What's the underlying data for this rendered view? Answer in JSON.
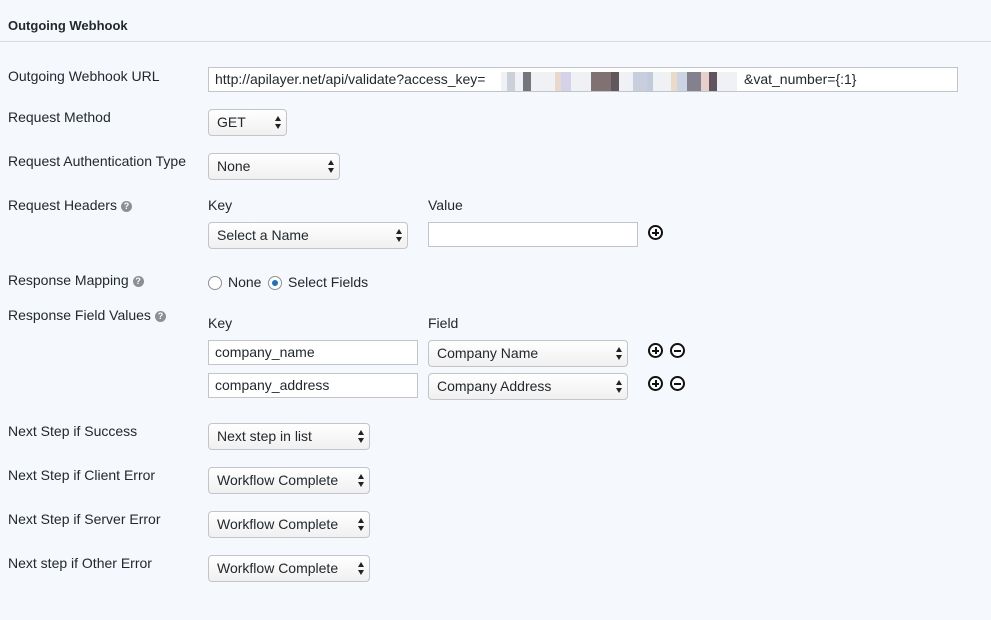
{
  "section": {
    "title": "Outgoing Webhook"
  },
  "fields": {
    "url": {
      "label": "Outgoing Webhook URL",
      "prefix": "http://apilayer.net/api/validate?access_key=",
      "suffix": "&vat_number={:1}"
    },
    "method": {
      "label": "Request Method",
      "value": "GET"
    },
    "auth": {
      "label": "Request Authentication Type",
      "value": "None"
    },
    "headers": {
      "label": "Request Headers",
      "key_head": "Key",
      "value_head": "Value",
      "key_value": "Select a Name",
      "value_value": ""
    },
    "mapping": {
      "label": "Response Mapping",
      "options": [
        {
          "label": "None",
          "checked": false
        },
        {
          "label": "Select Fields",
          "checked": true
        }
      ]
    },
    "field_values": {
      "label": "Response Field Values",
      "key_head": "Key",
      "field_head": "Field",
      "rows": [
        {
          "key": "company_name",
          "field": "Company Name"
        },
        {
          "key": "company_address",
          "field": "Company Address"
        }
      ]
    },
    "success": {
      "label": "Next Step if Success",
      "value": "Next step in list"
    },
    "client_error": {
      "label": "Next Step if Client Error",
      "value": "Workflow Complete"
    },
    "server_error": {
      "label": "Next Step if Server Error",
      "value": "Workflow Complete"
    },
    "other_error": {
      "label": "Next step if Other Error",
      "value": "Workflow Complete"
    }
  },
  "icons": {
    "help": "help-circle-icon",
    "add": "plus-circle-icon",
    "remove": "minus-circle-icon",
    "select": "updown-arrows-icon"
  },
  "colors": {
    "background": "#f5f9fd",
    "radio_accent": "#2271b1"
  }
}
